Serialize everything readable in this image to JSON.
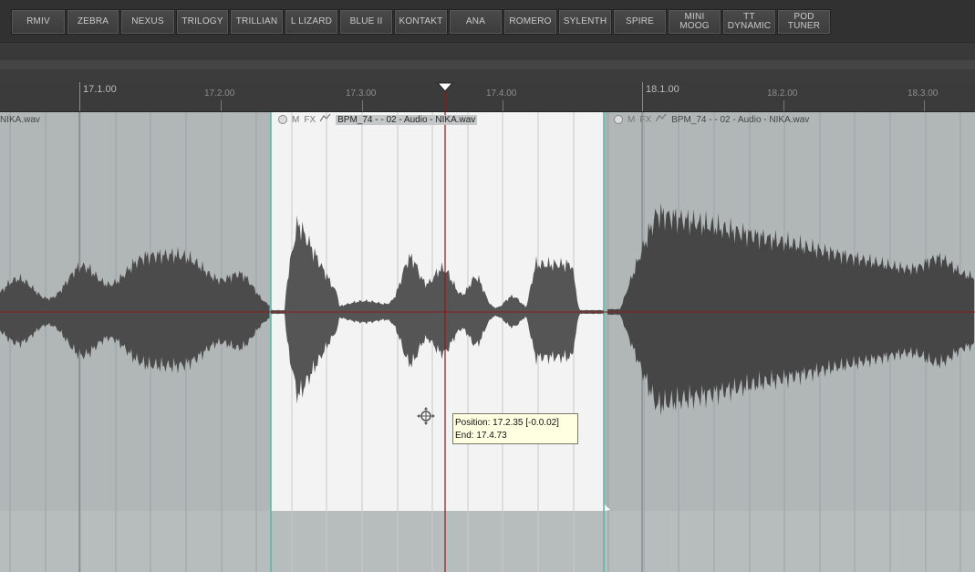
{
  "toolbar": {
    "buttons": [
      {
        "label": "RMIV"
      },
      {
        "label": "ZEBRA"
      },
      {
        "label": "NEXUS"
      },
      {
        "label": "TRILOGY"
      },
      {
        "label": "TRILLIAN"
      },
      {
        "label": "L LIZARD"
      },
      {
        "label": "BLUE II"
      },
      {
        "label": "KONTAKT"
      },
      {
        "label": "ANA"
      },
      {
        "label": "ROMERO"
      },
      {
        "label": "SYLENTH"
      },
      {
        "label": "SPIRE"
      },
      {
        "label": "MINI\nMOOG"
      },
      {
        "label": "TT\nDYNAMIC"
      },
      {
        "label": "POD\nTUNER"
      }
    ]
  },
  "ruler": {
    "bars": [
      {
        "label": "17.1.00"
      },
      {
        "label": "18.1.00"
      }
    ],
    "beats": [
      {
        "label": "17.2.00"
      },
      {
        "label": "17.3.00"
      },
      {
        "label": "17.4.00"
      },
      {
        "label": "18.2.00"
      },
      {
        "label": "18.3.00"
      }
    ]
  },
  "clips": {
    "left_tail_name": "NIKA.wav",
    "selected": {
      "mute_label": "M",
      "fx_label": "FX",
      "name": "BPM_74 - - 02 - Audio - NIKA.wav"
    },
    "right": {
      "mute_label": "M",
      "fx_label": "FX",
      "name": "BPM_74 - - 02 - Audio - NIKA.wav"
    }
  },
  "tooltip": {
    "position": "Position: 17.2.35 [-0.0.02]",
    "end": "End: 17.4.73"
  },
  "colors": {
    "toolbar_bg": "#313131",
    "track_bg": "#b1b6b7",
    "selected_clip_bg": "#f3f3f3",
    "waveform": "#4a4a4a",
    "playhead": "#8b1a1a",
    "tooltip_bg": "#ffffe1",
    "clip_edge": "#5fb3a8"
  }
}
